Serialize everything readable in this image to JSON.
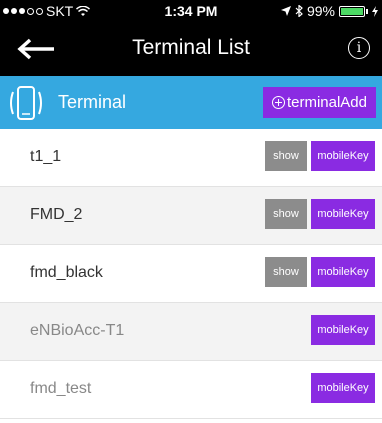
{
  "status_bar": {
    "carrier": "SKT",
    "time": "1:34 PM",
    "battery": "99%",
    "battery_level": 0.99
  },
  "nav": {
    "title": "Terminal List",
    "back_icon": "back-arrow-icon",
    "info_icon": "info-icon"
  },
  "section": {
    "label": "Terminal",
    "add_label": "terminalAdd"
  },
  "colors": {
    "header_blue": "#35a8e0",
    "button_purple": "#8a2be2",
    "button_gray": "#8c8c8c"
  },
  "terminals": [
    {
      "name": "t1_1",
      "show": "show",
      "key": "mobileKey"
    },
    {
      "name": "FMD_2",
      "show": "show",
      "key": "mobileKey"
    },
    {
      "name": "fmd_black",
      "show": "show",
      "key": "mobileKey"
    },
    {
      "name": "eNBioAcc-T1",
      "key": "mobileKey"
    },
    {
      "name": "fmd_test",
      "key": "mobileKey"
    }
  ]
}
